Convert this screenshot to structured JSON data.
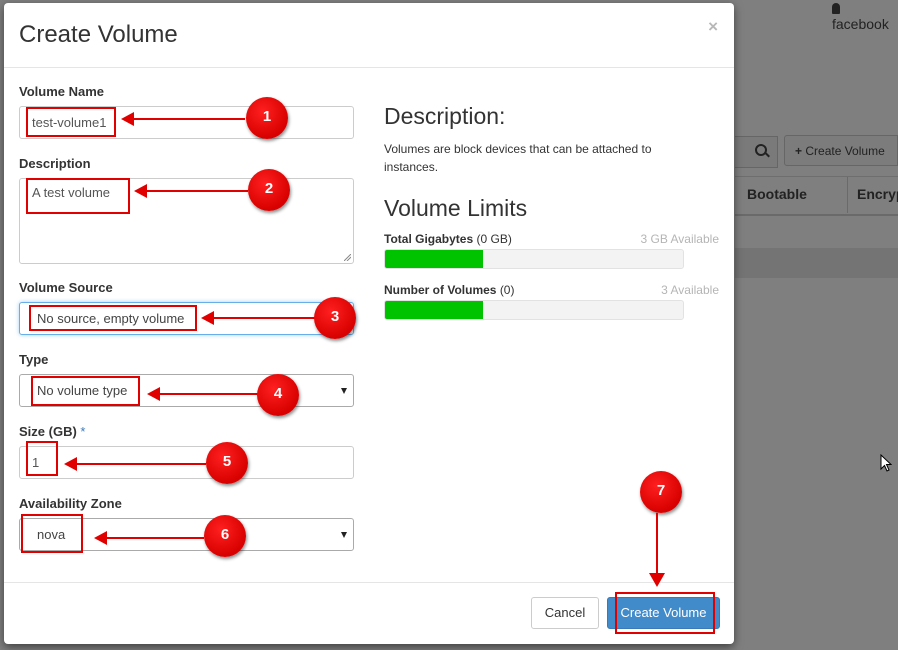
{
  "background": {
    "user_name": "facebook",
    "create_button_label": "Create Volume",
    "columns": [
      "Bootable",
      "Encryp"
    ]
  },
  "modal": {
    "title": "Create Volume",
    "close": "×",
    "fields": {
      "volume_name": {
        "label": "Volume Name",
        "value": "test-volume1"
      },
      "description": {
        "label": "Description",
        "value": "A test volume"
      },
      "volume_source": {
        "label": "Volume Source",
        "value": "No source, empty volume"
      },
      "type": {
        "label": "Type",
        "value": "No volume type"
      },
      "size": {
        "label": "Size (GB)",
        "required_mark": "*",
        "value": "1"
      },
      "availability_zone": {
        "label": "Availability Zone",
        "value": "nova"
      }
    },
    "description_panel": {
      "heading": "Description:",
      "text": "Volumes are block devices that can be attached to instances."
    },
    "limits": {
      "heading": "Volume Limits",
      "gigabytes": {
        "label": "Total Gigabytes",
        "used": "(0 GB)",
        "available": "3 GB Available",
        "fill_fraction": 0.33
      },
      "volumes": {
        "label": "Number of Volumes",
        "used": "(0)",
        "available": "3 Available",
        "fill_fraction": 0.33
      }
    },
    "footer": {
      "cancel_label": "Cancel",
      "create_label": "Create Volume"
    }
  },
  "annotations": {
    "colors": {
      "accent": "#e00000",
      "bar_fill": "#00c300",
      "primary_button": "#428bca"
    },
    "steps": [
      "1",
      "2",
      "3",
      "4",
      "5",
      "6",
      "7"
    ]
  }
}
